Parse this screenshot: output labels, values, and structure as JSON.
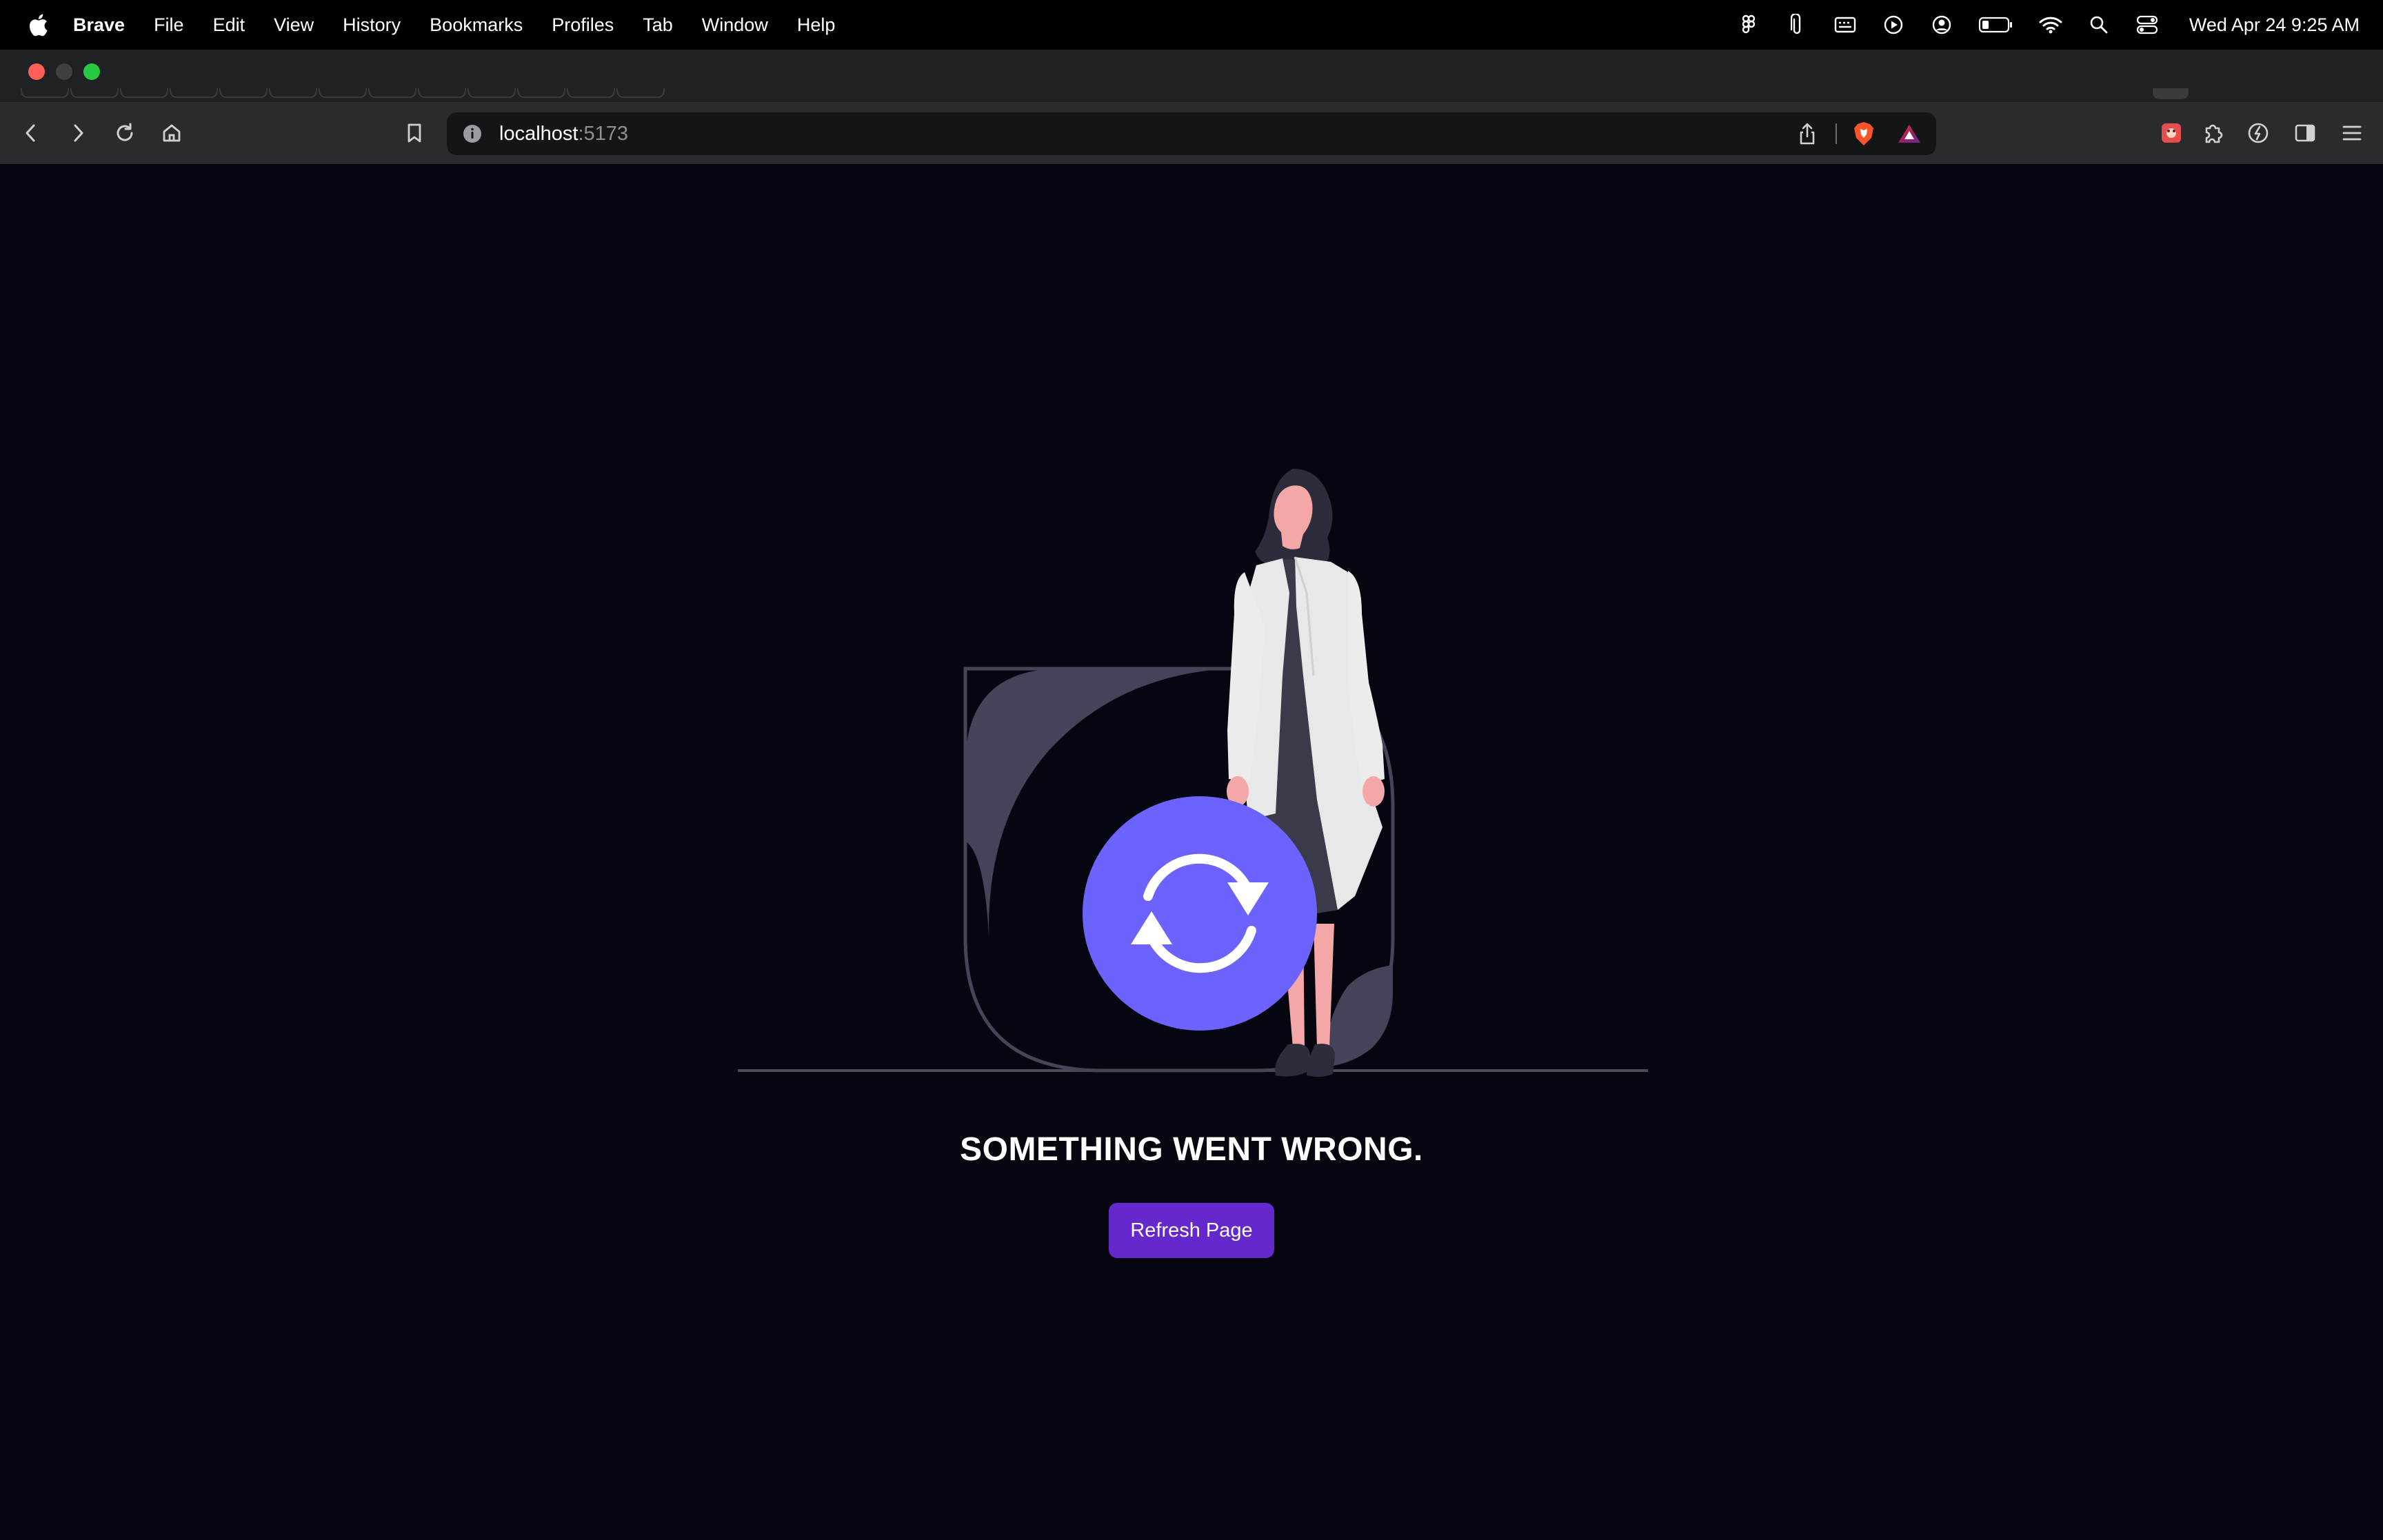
{
  "menubar": {
    "app_name": "Brave",
    "items": [
      "File",
      "Edit",
      "View",
      "History",
      "Bookmarks",
      "Profiles",
      "Tab",
      "Window",
      "Help"
    ],
    "clock": "Wed Apr 24  9:25 AM",
    "status_icons": [
      "figma-icon",
      "paperclip-icon",
      "keyboard-icon",
      "play-icon",
      "user-circle-icon",
      "battery-icon",
      "wifi-icon",
      "spotlight-search-icon",
      "control-center-icon"
    ]
  },
  "browser": {
    "url_host": "localhost",
    "url_port": ":5173"
  },
  "page": {
    "error_title": "SOMETHING WENT WRONG.",
    "refresh_label": "Refresh Page"
  },
  "colors": {
    "background": "#05060f",
    "button": "#6528cc",
    "illustration_accent": "#6c63ff",
    "close": "#ff5f57",
    "maximize": "#28c840"
  }
}
